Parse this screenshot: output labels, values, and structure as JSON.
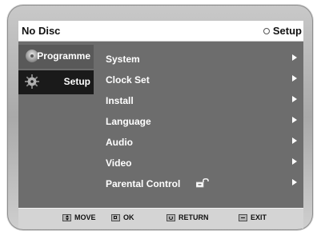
{
  "header": {
    "disc_status": "No Disc",
    "current_section": "Setup",
    "current_section_icon": "setup-circle-icon"
  },
  "sidebar": {
    "tabs": [
      {
        "label": "Programme",
        "icon": "programme-disc-icon",
        "selected": false
      },
      {
        "label": "Setup",
        "icon": "gear-icon",
        "selected": true
      }
    ]
  },
  "menu": {
    "items": [
      {
        "label": "System",
        "icon": "chevron-right-icon"
      },
      {
        "label": "Clock Set",
        "icon": "chevron-right-icon"
      },
      {
        "label": "Install",
        "icon": "chevron-right-icon"
      },
      {
        "label": "Language",
        "icon": "chevron-right-icon"
      },
      {
        "label": "Audio",
        "icon": "chevron-right-icon"
      },
      {
        "label": "Video",
        "icon": "chevron-right-icon"
      },
      {
        "label": "Parental Control",
        "icon": "chevron-right-icon",
        "extra_icon": "lock-icon"
      }
    ]
  },
  "footer": {
    "hints": [
      {
        "label": "MOVE",
        "icon": "move-icon"
      },
      {
        "label": "OK",
        "icon": "ok-icon"
      },
      {
        "label": "RETURN",
        "icon": "return-icon"
      },
      {
        "label": "EXIT",
        "icon": "exit-icon"
      }
    ]
  }
}
